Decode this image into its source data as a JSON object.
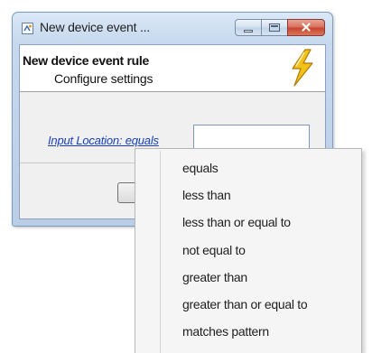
{
  "window": {
    "title": "New device event ...",
    "icon": "app-icon",
    "controls": {
      "minimize": "minimize-icon",
      "maximize": "maximize-icon",
      "close": "close-icon"
    },
    "close_color": "#c7442e"
  },
  "header": {
    "title": "New device event rule",
    "subtitle": "Configure settings",
    "icon": "lightning-icon",
    "icon_color": "#f2c21a"
  },
  "condition": {
    "link_label": "Input Location: equals",
    "link_color": "#1a3fb8",
    "value": "",
    "placeholder": ""
  },
  "operator_menu": {
    "items": [
      "equals",
      "less than",
      "less than or equal to",
      "not equal to",
      "greater than",
      "greater than or equal to",
      "matches pattern"
    ]
  }
}
